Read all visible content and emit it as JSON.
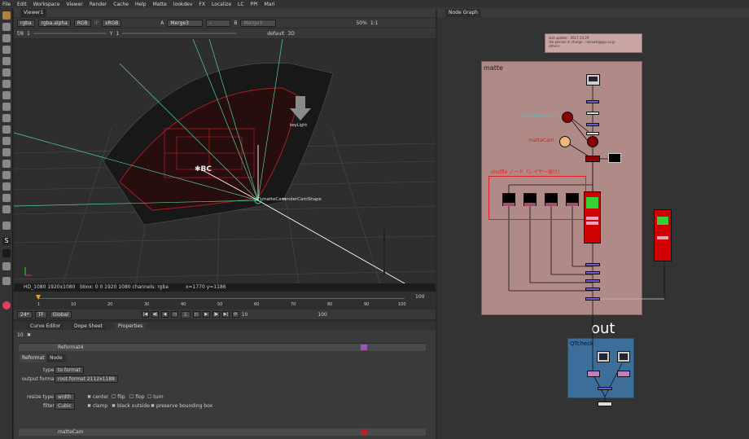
{
  "menu": [
    "File",
    "Edit",
    "Workspace",
    "Viewer",
    "Render",
    "Cache",
    "Help",
    "Matte",
    "lookdev",
    "FX",
    "Localize",
    "LC",
    "PPI",
    "Mari"
  ],
  "viewer_tab": "Viewer1",
  "viewer_controls": {
    "channels": "rgba",
    "alpha": "rgba.alpha",
    "colorspace_rgb": "RGB",
    "ip": "IP",
    "lut": "sRGB",
    "a_label": "A",
    "a_input": "Merge3",
    "b_label": "B",
    "b_input": "Merge3",
    "zoom": "50%",
    "ratio": "1:1"
  },
  "viewer_controls2": {
    "fstop": "f/8",
    "f_value": "1",
    "y_label": "Y",
    "y_value": "1",
    "mode": "default",
    "view": "3D"
  },
  "viewport": {
    "light_label": "keyLight",
    "cam_label": "renderCamShape",
    "cam_label2": "matteCam"
  },
  "info_bar": {
    "format": "HD_1080 1920x1080",
    "bbox": "bbox: 0 0 1920 1080 channels: rgba",
    "coords": "x=1770 y=1186"
  },
  "timeline": {
    "ticks": [
      "1",
      "10",
      "20",
      "30",
      "40",
      "50",
      "60",
      "70",
      "80",
      "90",
      "100"
    ],
    "current": "1",
    "end": "100"
  },
  "playback": {
    "fps": "24*",
    "tf": "TF",
    "global": "Global",
    "frame": "1",
    "step": "10",
    "end": "100"
  },
  "bottom_tabs": [
    "Curve Editor",
    "Dope Sheet",
    "Properties"
  ],
  "properties": {
    "count": "10",
    "node_name": "Reformat4",
    "tabs": [
      "Reformat",
      "Node"
    ],
    "type_label": "type",
    "type_value": "to format",
    "output_format_label": "output format",
    "output_format_value": "root.format 2112x1188",
    "resize_label": "resize type",
    "resize_value": "width",
    "center": "center",
    "flip": "flip",
    "flop": "flop",
    "turn": "turn",
    "filter_label": "filter",
    "filter_value": "Cubic",
    "clamp": "clamp",
    "black_outside": "black outside",
    "preserve_bbox": "preserve bounding box",
    "node2_name": "matteCam"
  },
  "node_graph": {
    "tab": "Node Graph",
    "sticky": [
      "last update : 2017.10.29",
      "the person in charge : nazuaki@ppi.co.jp",
      "others:"
    ],
    "backdrop_matte": "matte",
    "projection_cam": "projectionCam",
    "matte_cam": "matteCam",
    "shuffle_label": "shuffle ノード（レイヤー抜け）",
    "out_label": "out",
    "qtcheck_label": "QTcheck"
  },
  "colors": {
    "accent": "#f0a020",
    "backdrop_matte": "#b08a86",
    "backdrop_qt": "#3d6e9a",
    "node_red": "#d10000"
  }
}
